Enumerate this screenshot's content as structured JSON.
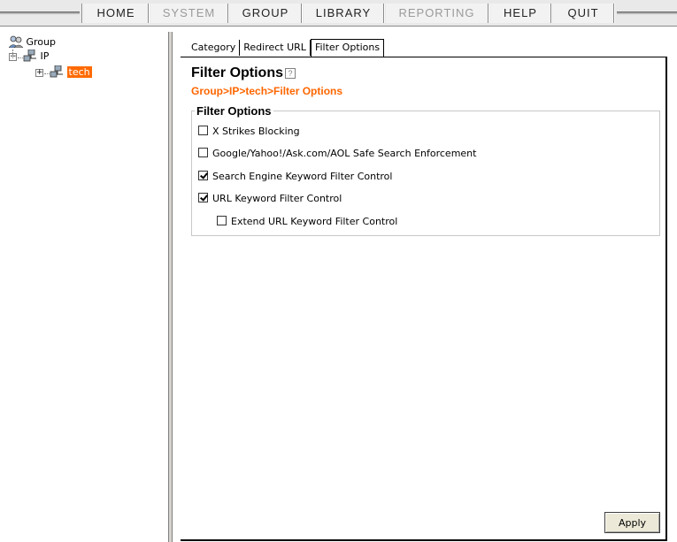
{
  "menu": {
    "items": [
      {
        "label": "HOME",
        "enabled": true
      },
      {
        "label": "SYSTEM",
        "enabled": false
      },
      {
        "label": "GROUP",
        "enabled": true
      },
      {
        "label": "LIBRARY",
        "enabled": true
      },
      {
        "label": "REPORTING",
        "enabled": false
      },
      {
        "label": "HELP",
        "enabled": true
      },
      {
        "label": "QUIT",
        "enabled": true
      }
    ]
  },
  "tree": {
    "root": {
      "label": "Group",
      "icon": "group-icon"
    },
    "child": {
      "label": "IP",
      "icon": "network-icon",
      "expander": "−"
    },
    "grandchild": {
      "label": "tech",
      "icon": "network-icon",
      "expander": "+",
      "selected": true
    }
  },
  "tabs": [
    {
      "label": "Category",
      "active": false
    },
    {
      "label": "Redirect URL",
      "active": false
    },
    {
      "label": "Filter Options",
      "active": true
    }
  ],
  "content": {
    "title": "Filter Options",
    "help_icon": "?",
    "breadcrumb": "Group>IP>tech>Filter Options"
  },
  "filter_options": {
    "legend": "Filter Options",
    "options": [
      {
        "label": "X Strikes Blocking",
        "checked": false
      },
      {
        "label": "Google/Yahoo!/Ask.com/AOL Safe Search Enforcement",
        "checked": false
      },
      {
        "label": "Search Engine Keyword Filter Control",
        "checked": true
      },
      {
        "label": "URL Keyword Filter Control",
        "checked": true
      },
      {
        "label": "Extend URL Keyword Filter Control",
        "checked": false
      }
    ]
  },
  "actions": {
    "apply_label": "Apply"
  },
  "colors": {
    "accent": "#ff6600",
    "selected_bg": "#ff6a00"
  }
}
